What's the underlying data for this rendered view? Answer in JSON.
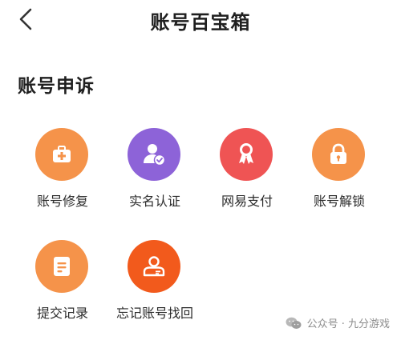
{
  "header": {
    "title": "账号百宝箱",
    "back_icon": "chevron-left-icon"
  },
  "section": {
    "title": "账号申诉"
  },
  "items": [
    {
      "label": "账号修复",
      "icon": "medical-kit-icon",
      "color": "#F5934A"
    },
    {
      "label": "实名认证",
      "icon": "user-verified-icon",
      "color": "#8D63D8"
    },
    {
      "label": "网易支付",
      "icon": "ribbon-icon",
      "color": "#EF5454"
    },
    {
      "label": "账号解锁",
      "icon": "lock-icon",
      "color": "#F5934A"
    },
    {
      "label": "提交记录",
      "icon": "document-icon",
      "color": "#F5934A"
    },
    {
      "label": "忘记账号找回",
      "icon": "id-card-icon",
      "color": "#F25A1C"
    }
  ],
  "watermark": {
    "text": "公众号 · 九分游戏",
    "icon": "wechat-icon"
  }
}
